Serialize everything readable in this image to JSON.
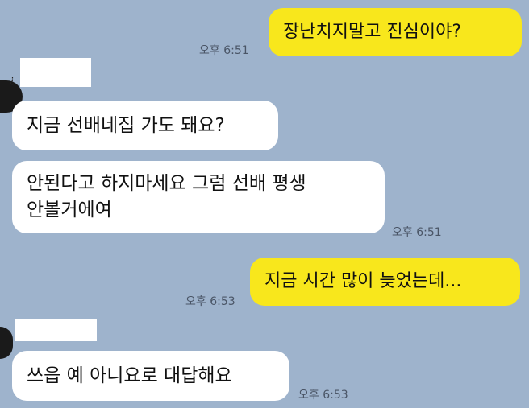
{
  "messages": [
    {
      "side": "me",
      "text": "장난치지말고 진심이야?",
      "time": "오후 6:51"
    },
    {
      "side": "other",
      "text": "지금 선배네집 가도 돼요?",
      "time": ""
    },
    {
      "side": "other",
      "lines": [
        "안된다고 하지마세요 그럼 선배 평생",
        "안볼거에여"
      ],
      "time": "오후 6:51"
    },
    {
      "side": "me",
      "text": "지금 시간 많이 늦었는데...",
      "time": "오후 6:53"
    },
    {
      "side": "other",
      "text": "쓰읍 예 아니요로 대답해요",
      "time": "오후 6:53"
    }
  ],
  "colors": {
    "background": "#9eb3cc",
    "my_bubble": "#f8e71c",
    "other_bubble": "#ffffff"
  }
}
